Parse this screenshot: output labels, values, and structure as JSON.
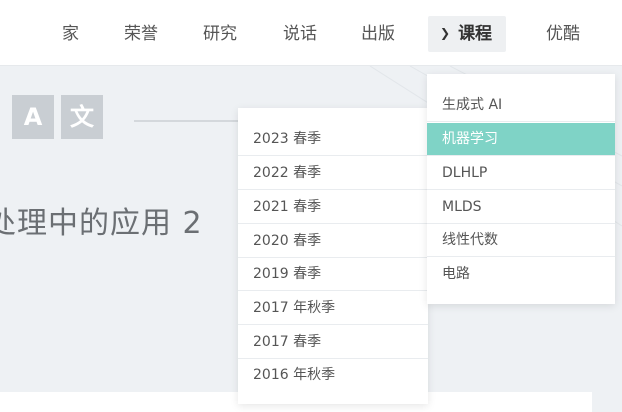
{
  "nav": {
    "items": [
      "家",
      "荣誉",
      "研究",
      "说话",
      "出版",
      "课程",
      "优酷"
    ],
    "active_index": 5
  },
  "hero": {
    "title": "处理中的应用 2",
    "logo_a": "A",
    "logo_b": "文"
  },
  "years_menu": {
    "items": [
      "2023 春季",
      "2022 春季",
      "2021 春季",
      "2020 春季",
      "2019 春季",
      "2017 年秋季",
      "2017 春季",
      "2016 年秋季"
    ]
  },
  "courses_menu": {
    "items": [
      "生成式 AI",
      "机器学习",
      "DLHLP",
      "MLDS",
      "线性代数",
      "电路"
    ],
    "selected_index": 1
  },
  "colors": {
    "selected": "#7fd3c6",
    "background": "#eef1f4"
  }
}
